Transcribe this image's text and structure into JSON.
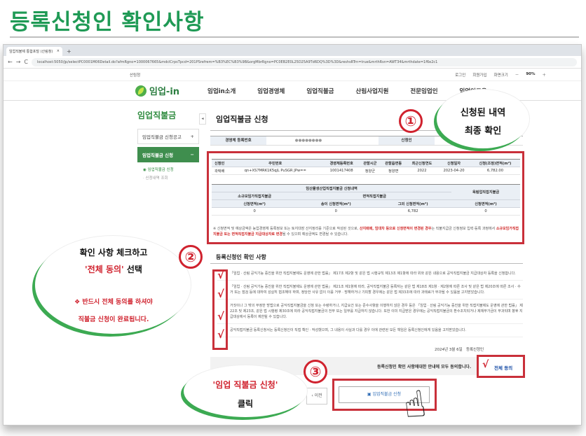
{
  "page_title": "등록신청인 확인사항",
  "browser": {
    "tab_label": "임업직불제 통합포털 (산림청)",
    "tab_close": "×",
    "new_tab": "+",
    "nav_back": "←",
    "nav_forward": "→",
    "nav_refresh": "C",
    "url": "localhost:5050/jp/selectPC0001M06Detail.do?afmRgno=1000067665&mdclCrpsTpcd=201PSrefrem=%B3%EC%B3%9B&orgMbrRgno=PC0EB2E0L25D25A9Td6DQ%3D%3D&reshsRTrn=true&mrthRsn=AWT34&mrthdate=1f6e2c1"
  },
  "topstrip": {
    "agency": "산림청",
    "links": [
      "로그인",
      "회원가입",
      "화면크기",
      "－",
      "90%",
      "＋"
    ]
  },
  "gnb": {
    "logo": "임업-in",
    "items": [
      "임업in소개",
      "임업경영체",
      "임업직불금",
      "산림사업지원",
      "전문임업인",
      "임업인교육"
    ]
  },
  "lnb": {
    "title": "임업직불금",
    "items": [
      {
        "label": "임업직불금 신청공고",
        "mark": "+"
      },
      {
        "label": "임업직불금 신청",
        "mark": "−"
      }
    ],
    "subitems": [
      "임업직불금 신청",
      "신청내역 조회"
    ],
    "toggle": "◂"
  },
  "content": {
    "title": "임업직불금 신청",
    "info_labels": [
      "경영체 등록번호",
      "신청인"
    ],
    "table1": {
      "headers": [
        "신청인",
        "주민번호",
        "경영체등록번호",
        "관할시군",
        "관할읍면동",
        "최근신청연도",
        "신청일자",
        "신청(조정)면적(m²)"
      ],
      "row": [
        "곽택배",
        "qn+XS7MRK1K5qjL PuSGR JPw==",
        "1001417408",
        "청양군",
        "청양면",
        "2022",
        "2023-04-20",
        "6,782.00"
      ]
    },
    "table2": {
      "group_left": "임산물생산업직접지불금 신청내역",
      "group_right": "육림업직접지불금",
      "sub_left": "소규모임가직접지불금",
      "sub_mid": "면적직접지불금",
      "cols": [
        "신청면적(m²)",
        "송이 신청면적(m²)",
        "그외 신청면적(m²)",
        "신청면적(m²)"
      ],
      "row": [
        "0",
        "0",
        "6,782",
        "0"
      ]
    },
    "note_a": "※ 신청면적 및 예상금액은 농업경영체 등록정보 또는 토지대장 산지정리를 기준으로 작성된 것으로, ",
    "note_red1": "산지매매, 임대차 등으로 신청면적이 변경된 경우",
    "note_b": "는 직불지급금 신청정보 입력·등록 과정에서 ",
    "note_red2": "소규모임가직접지불금 또는 면적직접지불금 지급대상자로 변경",
    "note_c": "될 수 있으며 예상금액도 변경될 수 있습니다.",
    "section_title": "등록신청인 확인 사항",
    "clauses": [
      "「임업 · 산림 공익기능 증진을 위한 직접지불제도 운영에 관한 법률」 제17조 제2항 및 같은 법 시행규칙 제13조 제1항에 따라 위와 같은 내용으로 공익직접지불금 지급대상자 등록을 신청합니다.",
      "「임업 · 산림 공익기능 증진을 위한 직접지불제도 운영에 관한 법률」 제21조 제1항에 따라, 공익직접지불금 등록자는 같은 법 제18조 제1항 · 제2항에 따른 조사 및 같은 법 제20조에 따른 조사 · 수거 또는 점검 등에 대하여 성실히 협조해야 하며, 정당한 사유 없이 이를 거부 · 방해하거나 기피할 경우에는 같은 법 제33조에 따라 과태료가 부과될 수 있음을 고지받았습니다.",
      "거짓이나 그 밖의 부정한 방법으로 공익직접지불금을 신청 또는 수령하거나, 지급요건 또는 준수사항을 이행하지 않은 경우 등은 「임업 · 산림 공익기능 증진을 위한 직접지불제도 운영에 관한 법률」 제22조 및 제23조, 같은 법 시행령 제30조에 따라 공익직접지불금의 전부 또는 일부를 지급하지 않습니다. 또한 이미 지급받은 경우에는 공익직접지불금의 환수조치되거나 제재부가금이 부과되며 향후 지급대상에서 등록이 제한될 수 있습니다.",
      "공익직접지불금 등록신청서는 등록신청인이 직접 확인 · 작성했으며, 그 내용이 사실과 다를 경우 이에 관련된 모든 책임은 등록신청인에게 있음을 고지받았습니다."
    ],
    "date": "2024년 3월 6일",
    "date_suffix": "등록신청인",
    "agree_text": "등록신청인 확인 사항에대한 안내에 모두 동의합니다.",
    "agree_label": "전체 동의",
    "prev_label": "이전",
    "apply_label": "임업직불금 신청"
  },
  "callouts": {
    "num1": "①",
    "num2": "②",
    "num3": "③",
    "check_mark": "√",
    "b1_line1": "신청된 내역",
    "b1_line2": "최종 확인",
    "b2_line1": "확인 사항 체크하고",
    "b2_red": "'전체 동의'",
    "b2_rest": " 선택",
    "b2_line3": "❖ 반드시 전체 동의를 하셔야",
    "b2_line4": "직불금 신청이 완료됩니다.",
    "b3_line1": "'임업 직불금 신청'",
    "b3_line2": "클릭"
  },
  "colors": {
    "brand_green": "#1f9a55",
    "highlight_red": "#c9303a",
    "nav_green": "#3f8e4e"
  }
}
